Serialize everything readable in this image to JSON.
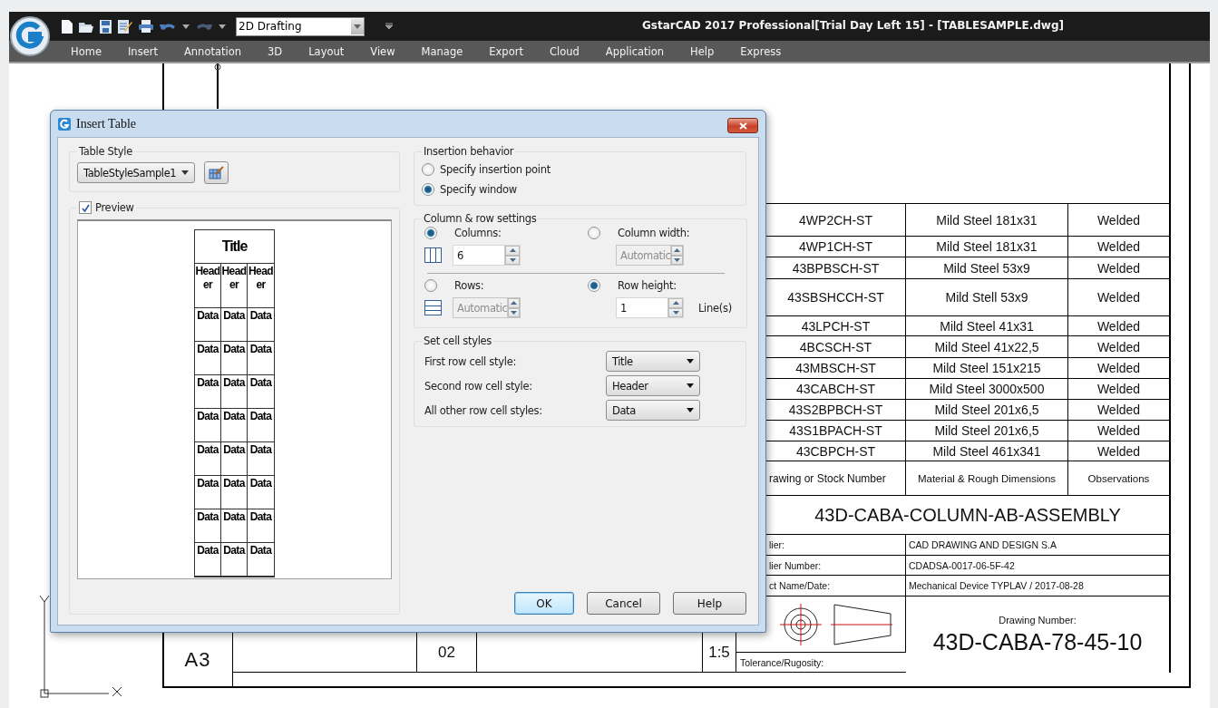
{
  "app": {
    "title": "GstarCAD 2017 Professional[Trial Day Left 15] - [TABLESAMPLE.dwg]",
    "workspace": "2D Drafting"
  },
  "ribbon_tabs": [
    "Home",
    "Insert",
    "Annotation",
    "3D",
    "Layout",
    "View",
    "Manage",
    "Export",
    "Cloud",
    "Application",
    "Help",
    "Express"
  ],
  "dialog": {
    "title": "Insert Table",
    "table_style": {
      "legend": "Table Style",
      "value": "TableStyleSample1"
    },
    "preview": {
      "label": "Preview",
      "checked": true,
      "title": "Title",
      "header": [
        "Header",
        "Header",
        "Header"
      ],
      "rows": [
        [
          "Data",
          "Data",
          "Data"
        ],
        [
          "Data",
          "Data",
          "Data"
        ],
        [
          "Data",
          "Data",
          "Data"
        ],
        [
          "Data",
          "Data",
          "Data"
        ],
        [
          "Data",
          "Data",
          "Data"
        ],
        [
          "Data",
          "Data",
          "Data"
        ],
        [
          "Data",
          "Data",
          "Data"
        ],
        [
          "Data",
          "Data",
          "Data"
        ]
      ]
    },
    "insertion": {
      "legend": "Insertion behavior",
      "options": [
        {
          "label": "Specify insertion point",
          "selected": false
        },
        {
          "label": "Specify window",
          "selected": true
        }
      ]
    },
    "column_row": {
      "legend": "Column & row settings",
      "settings": [
        {
          "kind": "columns",
          "label": "Columns:",
          "selected": true,
          "value": "6",
          "disabled": false
        },
        {
          "kind": "column_width",
          "label": "Column width:",
          "selected": false,
          "value": "Automatic",
          "disabled": true
        },
        {
          "kind": "rows",
          "label": "Rows:",
          "selected": false,
          "value": "Automatic",
          "disabled": true
        },
        {
          "kind": "row_height",
          "label": "Row height:",
          "selected": true,
          "value": "1",
          "disabled": false,
          "unit": "Line(s)"
        }
      ]
    },
    "cell_styles": {
      "legend": "Set cell styles",
      "rows": [
        {
          "label": "First row cell style:",
          "value": "Title"
        },
        {
          "label": "Second row cell style:",
          "value": "Header"
        },
        {
          "label": "All other row cell styles:",
          "value": "Data"
        }
      ]
    },
    "buttons": [
      {
        "label": "OK",
        "default": true
      },
      {
        "label": "Cancel",
        "default": false
      },
      {
        "label": "Help",
        "default": false
      }
    ]
  },
  "drawing": {
    "parts": [
      [
        "4WP2CH-ST",
        "Mild Steel 181x31",
        "Welded"
      ],
      [
        "4WP1CH-ST",
        "Mild Steel 181x31",
        "Welded"
      ],
      [
        "43BPBSCH-ST",
        "Mild Steel 53x9",
        "Welded"
      ],
      [
        "43SBSHCCH-ST",
        "Mild Stell 53x9",
        "Welded"
      ],
      [
        "43LPCH-ST",
        "Mild Steel 41x31",
        "Welded"
      ],
      [
        "4BCSCH-ST",
        "Mild Steel 41x22,5",
        "Welded"
      ],
      [
        "43MBSCH-ST",
        "Mild Steel 151x215",
        "Welded"
      ],
      [
        "43CABCH-ST",
        "Mild Steel 3000x500",
        "Welded"
      ],
      [
        "43S2BPBCH-ST",
        "Mild Steel 201x6,5",
        "Welded"
      ],
      [
        "43S1BPACH-ST",
        "Mild Steel 201x6,5",
        "Welded"
      ],
      [
        "43CBPCH-ST",
        "Mild Steel 461x341",
        "Welded"
      ]
    ],
    "headings": [
      "rawing or Stock Number",
      "Material & Rough Dimensions",
      "Observations"
    ],
    "assembly": "43D-CABA-COLUMN-AB-ASSEMBLY",
    "info": [
      {
        "label": "lier:",
        "value": "CAD DRAWING AND DESIGN S.A"
      },
      {
        "label": "lier Number:",
        "value": "CDADSA-0017-06-5F-42"
      },
      {
        "label": "ct Name/Date:",
        "value": "Mechanical Device TYPLAV / 2017-08-28"
      }
    ],
    "drawing_number_label": "Drawing Number:",
    "drawing_number": "43D-CABA-78-45-10",
    "tolerance_label": "Tolerance/Rugosity:",
    "sheet_size": "A3",
    "sheet": "02",
    "scale": "1:5"
  }
}
